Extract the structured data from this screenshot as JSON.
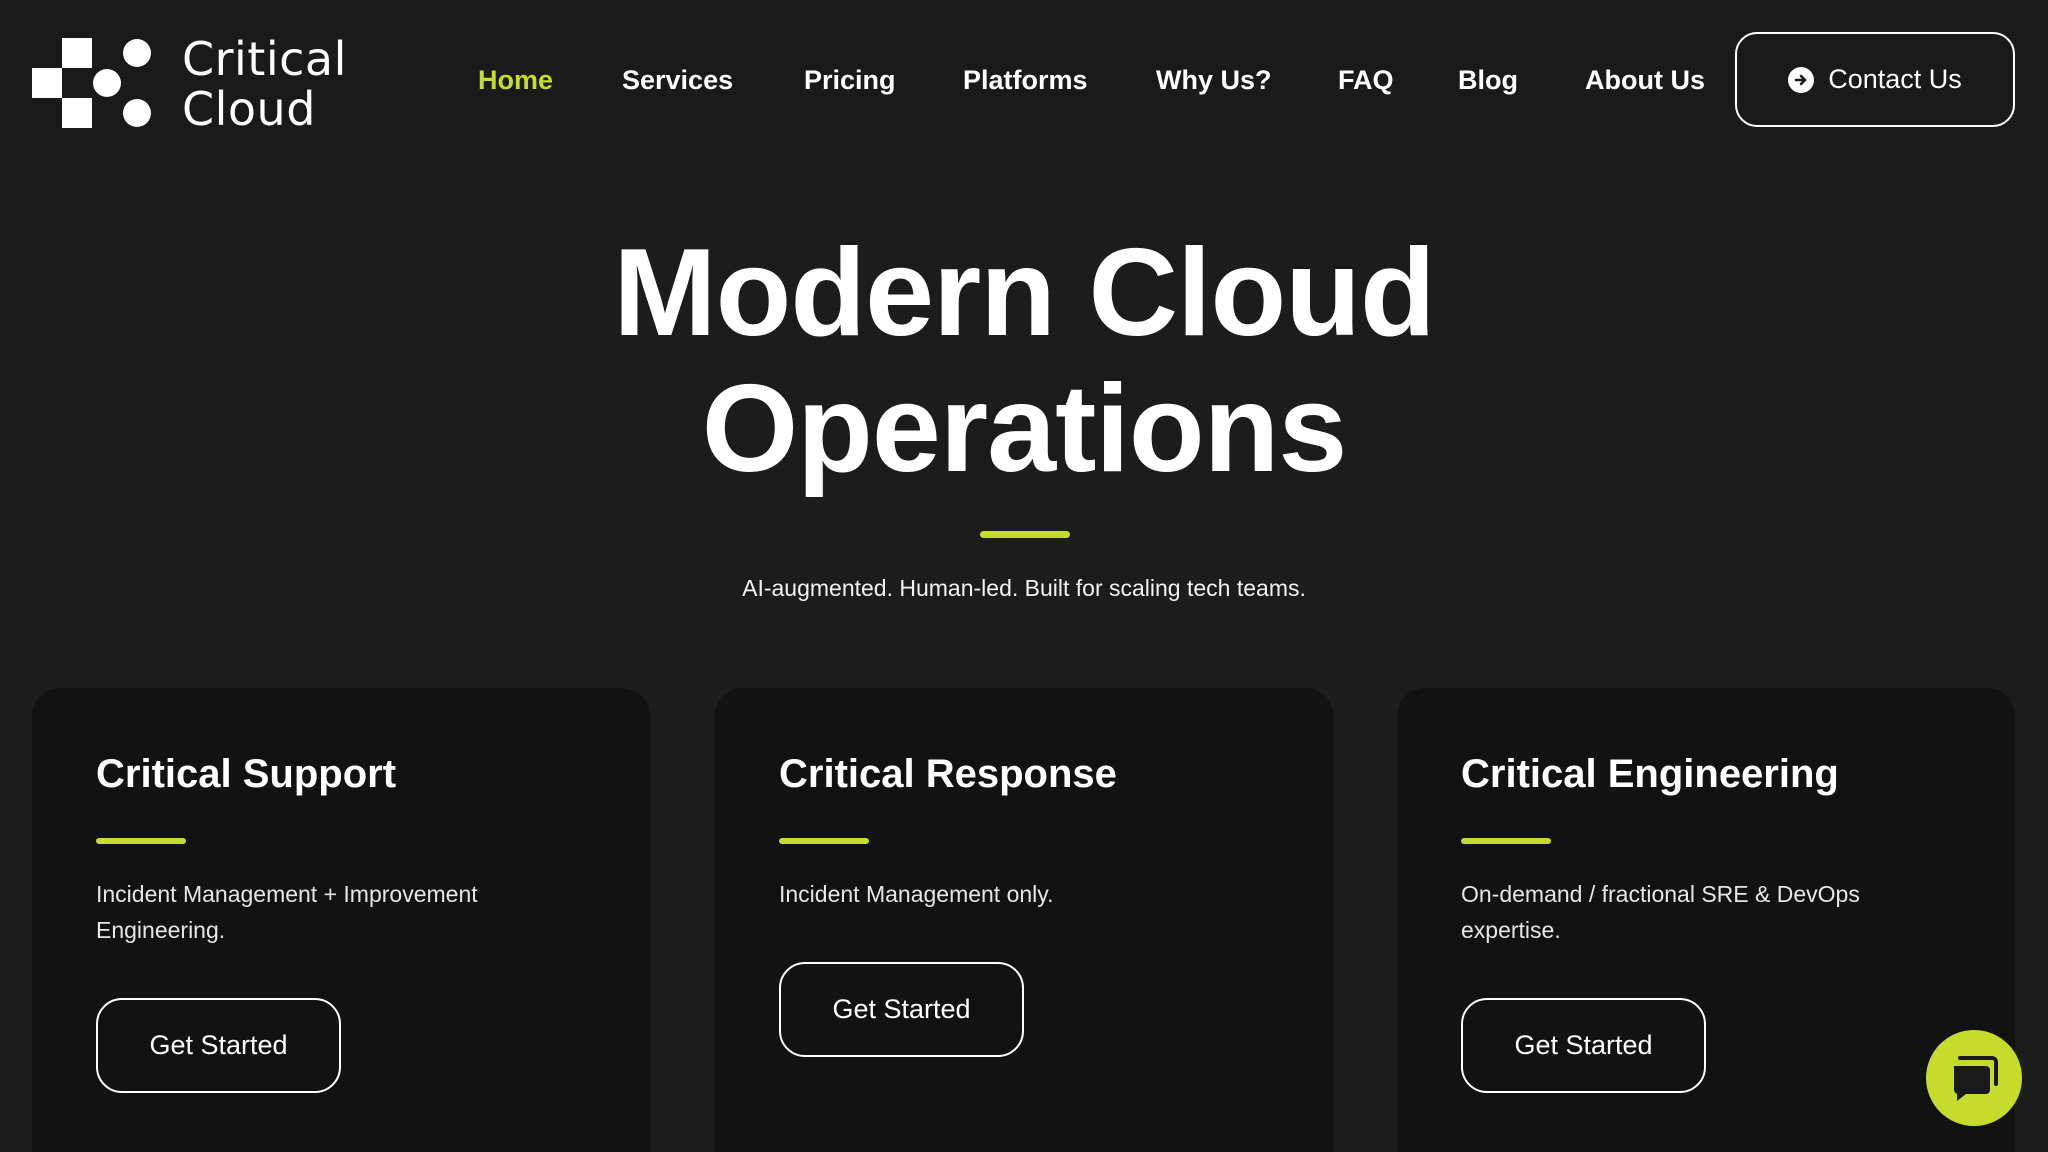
{
  "brand": {
    "line1": "Critical",
    "line2": "Cloud"
  },
  "nav": {
    "items": [
      {
        "label": "Home",
        "active": true
      },
      {
        "label": "Services"
      },
      {
        "label": "Pricing"
      },
      {
        "label": "Platforms"
      },
      {
        "label": "Why Us?"
      },
      {
        "label": "FAQ"
      },
      {
        "label": "Blog"
      },
      {
        "label": "About Us"
      }
    ],
    "contact_label": "Contact Us",
    "contact_icon": "arrow-right-circle-icon"
  },
  "hero": {
    "title_line1": "Modern Cloud",
    "title_line2": "Operations",
    "subtitle": "AI-augmented. Human-led. Built for scaling tech teams."
  },
  "cards": [
    {
      "title": "Critical Support",
      "description": "Incident Management + Improvement Engineering.",
      "button": "Get Started"
    },
    {
      "title": "Critical Response",
      "description": "Incident Management only.",
      "button": "Get Started"
    },
    {
      "title": "Critical Engineering",
      "description": "On-demand / fractional SRE & DevOps expertise.",
      "button": "Get Started"
    }
  ],
  "chat": {
    "icon": "chat-bubble-icon"
  },
  "colors": {
    "accent": "#c6dc2a",
    "background": "#1c1c1d",
    "card": "#121212",
    "text": "#ffffff"
  }
}
